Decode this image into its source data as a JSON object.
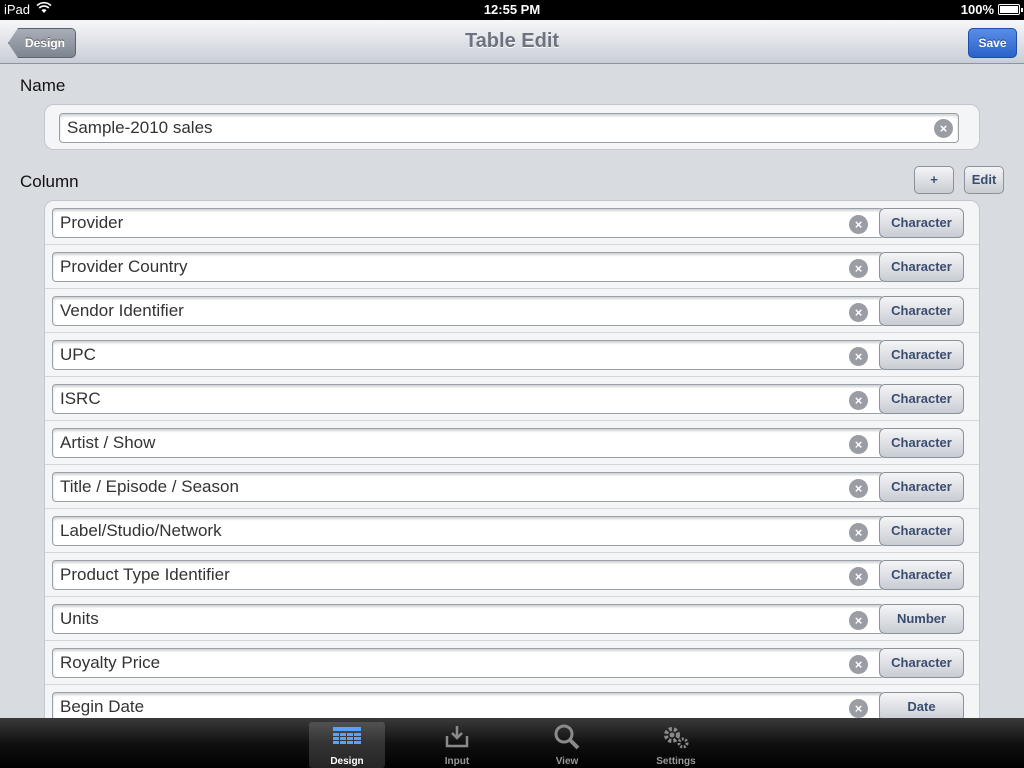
{
  "status_bar": {
    "device": "iPad",
    "time": "12:55 PM",
    "battery": "100%"
  },
  "nav_bar": {
    "back_label": "Design",
    "title": "Table Edit",
    "save_label": "Save"
  },
  "name_section": {
    "label": "Name",
    "value": "Sample-2010 sales"
  },
  "column_section": {
    "label": "Column",
    "add_label": "+",
    "edit_label": "Edit",
    "rows": [
      {
        "name": "Provider",
        "type": "Character"
      },
      {
        "name": "Provider Country",
        "type": "Character"
      },
      {
        "name": "Vendor Identifier",
        "type": "Character"
      },
      {
        "name": "UPC",
        "type": "Character"
      },
      {
        "name": "ISRC",
        "type": "Character"
      },
      {
        "name": "Artist / Show",
        "type": "Character"
      },
      {
        "name": "Title / Episode / Season",
        "type": "Character"
      },
      {
        "name": "Label/Studio/Network",
        "type": "Character"
      },
      {
        "name": "Product Type Identifier",
        "type": "Character"
      },
      {
        "name": "Units",
        "type": "Number"
      },
      {
        "name": "Royalty Price",
        "type": "Character"
      },
      {
        "name": "Begin Date",
        "type": "Date"
      }
    ]
  },
  "tab_bar": {
    "tabs": [
      {
        "label": "Design",
        "icon": "grid-icon",
        "active": true
      },
      {
        "label": "Input",
        "icon": "inbox-icon",
        "active": false
      },
      {
        "label": "View",
        "icon": "magnifier-icon",
        "active": false
      },
      {
        "label": "Settings",
        "icon": "gear-icon",
        "active": false
      }
    ]
  },
  "colors": {
    "accent": "#2a62c9",
    "background": "#d8dbe0",
    "button_text": "#3b4d6e"
  }
}
